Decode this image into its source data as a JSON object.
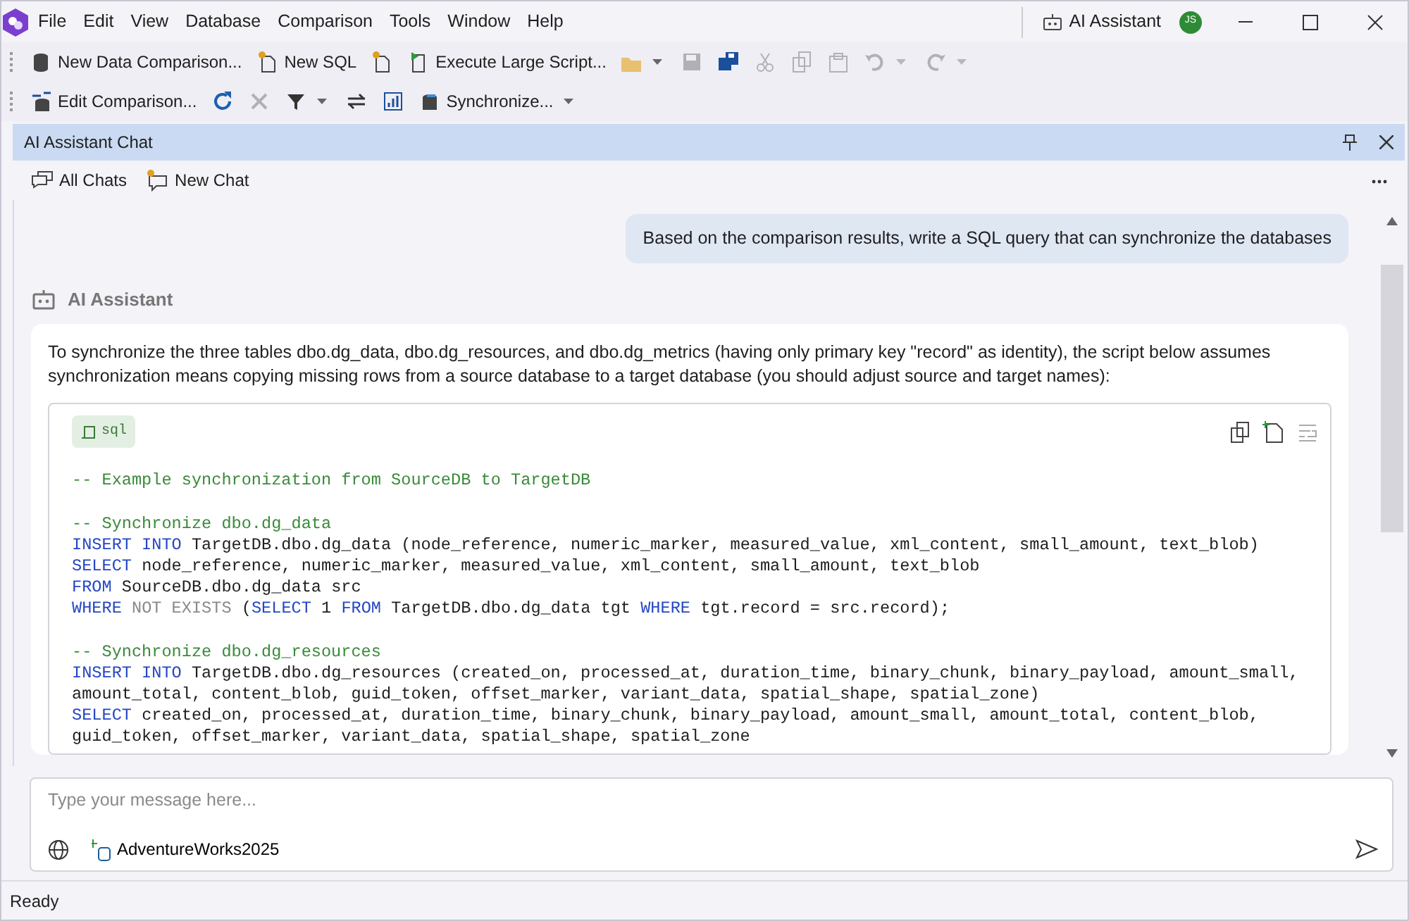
{
  "menu": [
    "File",
    "Edit",
    "View",
    "Database",
    "Comparison",
    "Tools",
    "Window",
    "Help"
  ],
  "title_bar": {
    "assistant_button": "AI Assistant",
    "avatar": "JS"
  },
  "toolbars": [
    {
      "items": [
        {
          "label": "New Data Comparison...",
          "disabled": false,
          "dropdown": false
        },
        {
          "label": "New SQL",
          "disabled": false,
          "dropdown": false
        },
        {
          "disabled": false,
          "dropdown": false
        },
        {
          "label": "Execute Large Script...",
          "disabled": false,
          "dropdown": false
        },
        {
          "disabled": false,
          "dropdown": true
        },
        {
          "disabled": true,
          "dropdown": false
        },
        {
          "disabled": false,
          "dropdown": false
        },
        {
          "disabled": true,
          "dropdown": false
        },
        {
          "disabled": true,
          "dropdown": false
        },
        {
          "disabled": true,
          "dropdown": false
        },
        {
          "disabled": true,
          "dropdown": true
        },
        {
          "disabled": true,
          "dropdown": true
        }
      ]
    },
    {
      "items": [
        {
          "label": "Edit Comparison...",
          "disabled": false,
          "dropdown": false
        },
        {
          "disabled": false,
          "dropdown": false
        },
        {
          "disabled": true,
          "dropdown": false
        },
        {
          "disabled": false,
          "dropdown": true
        },
        {
          "disabled": false,
          "dropdown": false
        },
        {
          "disabled": false,
          "dropdown": false
        },
        {
          "label": "Synchronize...",
          "disabled": false,
          "dropdown": true
        }
      ]
    }
  ],
  "panel": {
    "title": "AI Assistant Chat"
  },
  "chat_toolbar": [
    "All Chats",
    "New Chat"
  ],
  "user_message": "Based on the comparison results, write a SQL query that can synchronize the databases",
  "assistant": {
    "name": "AI Assistant",
    "text": "To synchronize the three tables dbo.dg_data, dbo.dg_resources, and dbo.dg_metrics (having only primary key \"record\" as identity), the script below assumes synchronization means copying missing rows from a source database to a target database (you should adjust source and target names):",
    "code": {
      "language": "sql",
      "blocks": [
        [
          [
            {
              "kind": "comment",
              "text": "-- Example synchronization from SourceDB to TargetDB"
            }
          ]
        ],
        [
          [
            {
              "kind": "comment",
              "text": "-- Synchronize dbo.dg_data"
            }
          ],
          [
            {
              "kind": "keyword",
              "text": "INSERT INTO"
            },
            {
              "kind": "plain",
              "text": " TargetDB.dbo.dg_data (node_reference, numeric_marker, measured_value, xml_content, small_amount, text_blob)"
            }
          ],
          [
            {
              "kind": "keyword",
              "text": "SELECT"
            },
            {
              "kind": "plain",
              "text": " node_reference, numeric_marker, measured_value, xml_content, small_amount, text_blob"
            }
          ],
          [
            {
              "kind": "keyword",
              "text": "FROM"
            },
            {
              "kind": "plain",
              "text": " SourceDB.dbo.dg_data src"
            }
          ],
          [
            {
              "kind": "keyword",
              "text": "WHERE"
            },
            {
              "kind": "operator",
              "text": " NOT EXISTS "
            },
            {
              "kind": "plain",
              "text": "("
            },
            {
              "kind": "keyword",
              "text": "SELECT"
            },
            {
              "kind": "plain",
              "text": " 1 "
            },
            {
              "kind": "keyword",
              "text": "FROM"
            },
            {
              "kind": "plain",
              "text": " TargetDB.dbo.dg_data tgt "
            },
            {
              "kind": "keyword",
              "text": "WHERE"
            },
            {
              "kind": "plain",
              "text": " tgt.record = src.record);"
            }
          ]
        ],
        [
          [
            {
              "kind": "comment",
              "text": "-- Synchronize dbo.dg_resources"
            }
          ],
          [
            {
              "kind": "keyword",
              "text": "INSERT INTO"
            },
            {
              "kind": "plain",
              "text": " TargetDB.dbo.dg_resources (created_on, processed_at, duration_time, binary_chunk, binary_payload, amount_small,"
            }
          ],
          [
            {
              "kind": "plain",
              "text": "amount_total, content_blob, guid_token, offset_marker, variant_data, spatial_shape, spatial_zone)"
            }
          ],
          [
            {
              "kind": "keyword",
              "text": "SELECT"
            },
            {
              "kind": "plain",
              "text": " created_on, processed_at, duration_time, binary_chunk, binary_payload, amount_small, amount_total, content_blob,"
            }
          ],
          [
            {
              "kind": "plain",
              "text": "guid_token, offset_marker, variant_data, spatial_shape, spatial_zone"
            }
          ]
        ]
      ]
    }
  },
  "input": {
    "placeholder": "Type your message here...",
    "database": "AdventureWorks2025"
  },
  "status_bar": "Ready"
}
